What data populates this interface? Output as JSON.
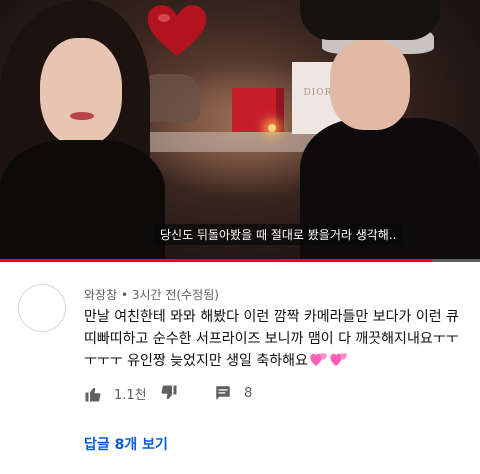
{
  "video": {
    "subtitle": "당신도 뒤돌아봤을 때 절대로 봤을거라 생각해..",
    "bag_brand": "DIOR",
    "progress": 0.9
  },
  "comment": {
    "author": "와장창",
    "separator": "•",
    "time": "3시간 전(수정됨)",
    "text": "만날 여친한테 뫄뫄 해봤다 이런 깜짝 카메라들만 보다가 이런 큐띠빠띠하고 순수한 서프라이즈 보니까 맴이 다 깨끗해지내요ㅜㅜㅜㅜㅜ 유인짱 늦었지만 생일 축하해요",
    "emoji": "two-hearts",
    "likes": "1.1천",
    "comment_count": "8",
    "replies_label": "답글 8개 보기"
  },
  "colors": {
    "progress": "#ff0000",
    "link": "#065fd4",
    "heart": "#ff5fb4"
  }
}
